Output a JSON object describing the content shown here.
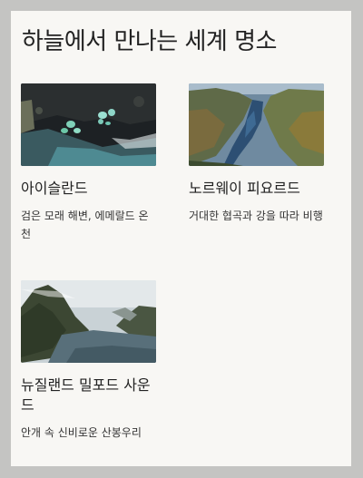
{
  "page": {
    "title": "하늘에서 만나는 세계 명소"
  },
  "places": [
    {
      "name": "아이슬란드",
      "desc": "검은 모래 해변, 에메랄드 온천",
      "image": "iceland-aerial-hot-springs-photo"
    },
    {
      "name": "노르웨이 피요르드",
      "desc": "거대한 협곡과 강을 따라 비행",
      "image": "norway-fjord-aerial-photo"
    },
    {
      "name": "뉴질랜드 밀포드 사운드",
      "desc": "안개 속 신비로운 산봉우리",
      "image": "milford-sound-misty-mountains-photo"
    }
  ],
  "colors": {
    "background": "#c4c4c2",
    "card": "#f8f7f4",
    "text": "#222222"
  }
}
